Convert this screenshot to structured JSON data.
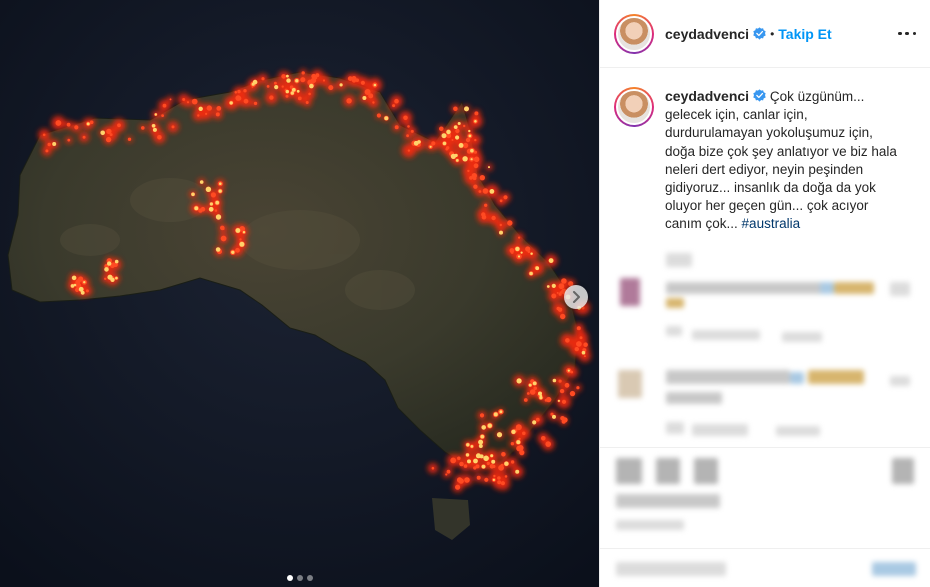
{
  "header": {
    "username": "ceydadvenci",
    "verified_icon": "verified-badge-icon",
    "separator": "•",
    "follow_label": "Takip Et",
    "more_icon": "more-options-icon"
  },
  "caption": {
    "username": "ceydadvenci",
    "text": "Çok üzgünüm... gelecek için, canlar için, durdurulamayan yokoluşumuz için, doğa bize çok şey anlatıyor ve biz hala neleri dert ediyor, neyin peşinden gidiyoruz... insanlık da doğa da yok oluyor her geçen gün... çok acıyor canım çok...",
    "hashtag": "#australia"
  },
  "media": {
    "next_icon": "chevron-right-icon",
    "carousel_count": 3,
    "carousel_active": 0
  },
  "colors": {
    "accent": "#0095f6",
    "hashtag": "#00376b",
    "fire": "#ff3b1f",
    "fire_core": "#ffd36b"
  }
}
